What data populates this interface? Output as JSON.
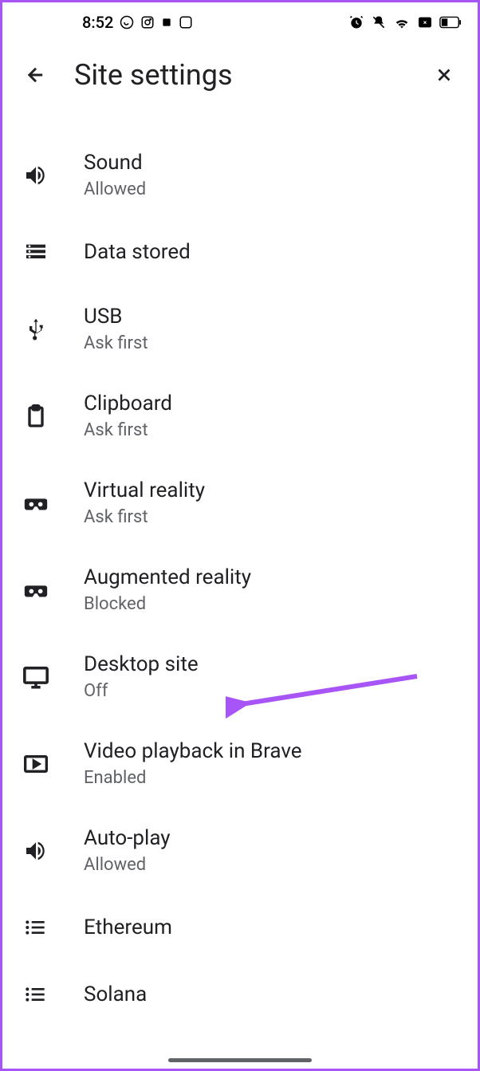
{
  "status": {
    "time": "8:52"
  },
  "header": {
    "title": "Site settings"
  },
  "settings": [
    {
      "title": "Sound",
      "subtitle": "Allowed",
      "icon": "sound"
    },
    {
      "title": "Data stored",
      "subtitle": "",
      "icon": "data"
    },
    {
      "title": "USB",
      "subtitle": "Ask first",
      "icon": "usb"
    },
    {
      "title": "Clipboard",
      "subtitle": "Ask first",
      "icon": "clipboard"
    },
    {
      "title": "Virtual reality",
      "subtitle": "Ask first",
      "icon": "vr"
    },
    {
      "title": "Augmented reality",
      "subtitle": "Blocked",
      "icon": "vr"
    },
    {
      "title": "Desktop site",
      "subtitle": "Off",
      "icon": "desktop"
    },
    {
      "title": "Video playback in Brave",
      "subtitle": "Enabled",
      "icon": "video"
    },
    {
      "title": "Auto-play",
      "subtitle": "Allowed",
      "icon": "sound"
    },
    {
      "title": "Ethereum",
      "subtitle": "",
      "icon": "list"
    },
    {
      "title": "Solana",
      "subtitle": "",
      "icon": "list"
    }
  ]
}
